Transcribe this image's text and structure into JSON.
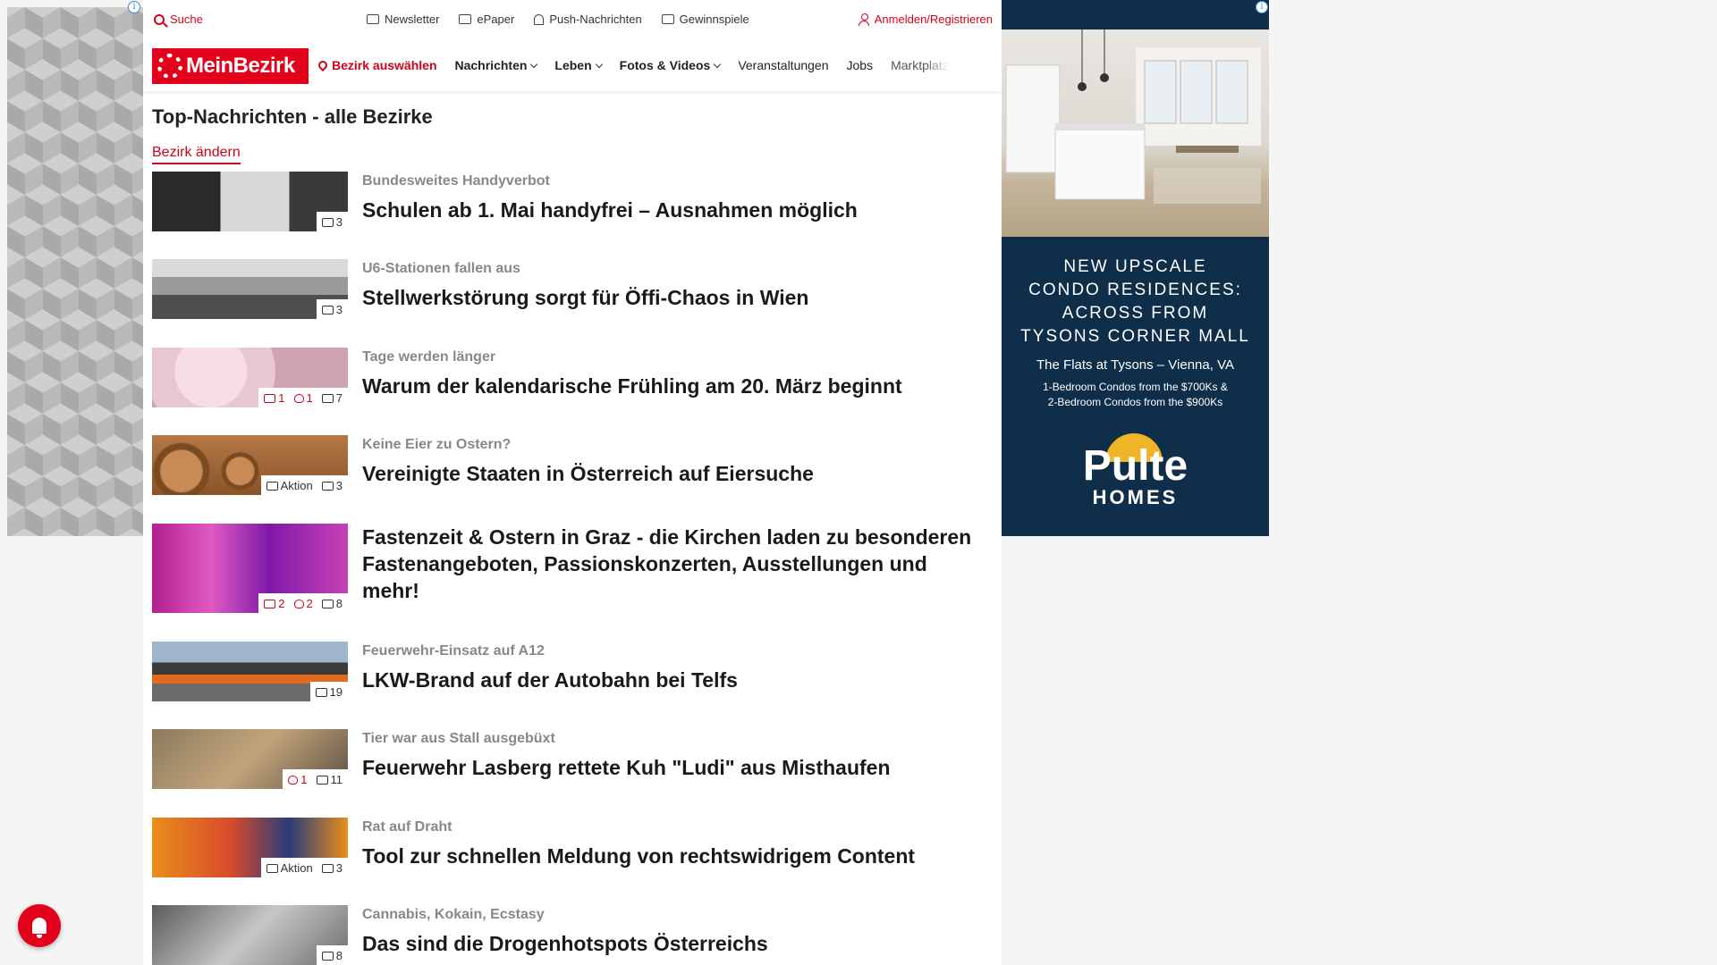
{
  "topbar": {
    "search": "Suche",
    "links": [
      "Newsletter",
      "ePaper",
      "Push-Nachrichten",
      "Gewinnspiele"
    ],
    "login": "Anmelden/Registrieren"
  },
  "nav": {
    "logo": "MeinBezirk",
    "region": "Bezirk auswählen",
    "items": [
      "Nachrichten",
      "Leben",
      "Fotos & Videos",
      "Veranstaltungen",
      "Jobs",
      "Marktplatz"
    ]
  },
  "page": {
    "title": "Top-Nachrichten - alle Bezirke",
    "change_region": "Bezirk ändern"
  },
  "articles": [
    {
      "kicker": "Bundesweites Handyverbot",
      "headline": "Schulen ab 1. Mai handyfrei – Ausnahmen möglich",
      "photos": "3",
      "comments": "",
      "likes": "",
      "aktion": ""
    },
    {
      "kicker": "U6-Stationen fallen aus",
      "headline": "Stellwerkstörung sorgt für Öffi-Chaos in Wien",
      "photos": "3",
      "comments": "",
      "likes": "",
      "aktion": ""
    },
    {
      "kicker": "Tage werden länger",
      "headline": "Warum der kalendarische Frühling am 20. März beginnt",
      "photos": "7",
      "comments": "1",
      "likes": "1",
      "aktion": ""
    },
    {
      "kicker": "Keine Eier zu Ostern?",
      "headline": "Vereinigte Staaten in Österreich auf Eiersuche",
      "photos": "3",
      "comments": "",
      "likes": "",
      "aktion": "Aktion"
    },
    {
      "kicker": "",
      "headline": "Fastenzeit & Ostern in Graz - die Kirchen laden zu besonderen Fastenangeboten, Passionskonzerten, Ausstellungen und mehr!",
      "photos": "8",
      "comments": "2",
      "likes": "2",
      "aktion": ""
    },
    {
      "kicker": "Feuerwehr-Einsatz auf A12",
      "headline": "LKW-Brand auf der Autobahn bei Telfs",
      "photos": "19",
      "comments": "",
      "likes": "",
      "aktion": ""
    },
    {
      "kicker": "Tier war aus Stall ausgebüxt",
      "headline": "Feuerwehr Lasberg rettete Kuh \"Ludi\" aus Misthaufen",
      "photos": "11",
      "comments": "",
      "likes": "1",
      "aktion": ""
    },
    {
      "kicker": "Rat auf Draht",
      "headline": "Tool zur schnellen Meldung von rechtswidrigem Content",
      "photos": "3",
      "comments": "",
      "likes": "",
      "aktion": "Aktion"
    },
    {
      "kicker": "Cannabis, Kokain, Ecstasy",
      "headline": "Das sind die Drogenhotspots Österreichs",
      "photos": "8",
      "comments": "",
      "likes": "",
      "aktion": ""
    }
  ],
  "ad": {
    "headline": [
      "NEW UPSCALE",
      "CONDO RESIDENCES:",
      "ACROSS FROM",
      "TYSONS CORNER MALL"
    ],
    "sub": "The Flats at Tysons – Vienna, VA",
    "details": [
      "1-Bedroom Condos from the $700Ks &",
      "2-Bedroom Condos from the $900Ks"
    ],
    "brand_top": "Pulte",
    "brand_bottom": "HOMES"
  },
  "colors": {
    "accent": "#e2001a",
    "ad_bg": "#0f2e4a"
  }
}
